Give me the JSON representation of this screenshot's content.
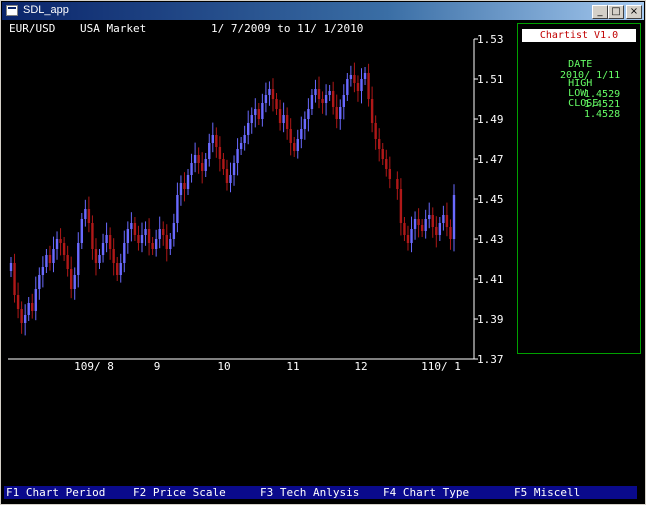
{
  "window": {
    "title": "SDL_app",
    "minimize_glyph": "_",
    "maximize_glyph": "□",
    "close_glyph": "×"
  },
  "chart_header": {
    "pair": "EUR/USD",
    "market": "USA Market",
    "range": "1/ 7/2009 to 11/ 1/2010"
  },
  "info_panel": {
    "badge": "Chartist V1.0",
    "date_label": "DATE",
    "date_value": "2010/ 1/11",
    "high_label": "HIGH",
    "high_value": "1.4529",
    "low_label": "LOW",
    "low_value": "1.4521",
    "close_label": "CLOSE",
    "close_value": "1.4528"
  },
  "menu": [
    {
      "key": "F1",
      "label": "F1 Chart Period"
    },
    {
      "key": "F2",
      "label": "F2 Price Scale"
    },
    {
      "key": "F3",
      "label": "F3 Tech Anlysis"
    },
    {
      "key": "F4",
      "label": "F4 Chart Type"
    },
    {
      "key": "F5",
      "label": "F5 Miscell"
    }
  ],
  "colors": {
    "up": "#6a6aff",
    "down": "#b01818",
    "axis": "#ffffff",
    "info_text": "#66ff66",
    "panel_border": "#00a000",
    "menu_bg": "#0a0a8c"
  },
  "chart_data": {
    "type": "candlestick",
    "ylim": [
      1.37,
      1.53
    ],
    "y_ticks": [
      1.53,
      1.51,
      1.49,
      1.47,
      1.45,
      1.43,
      1.41,
      1.39,
      1.37
    ],
    "x_ticks": [
      "109/ 8",
      "9",
      "10",
      "11",
      "12",
      "110/ 1"
    ],
    "close": [
      1.418,
      1.402,
      1.395,
      1.388,
      1.392,
      1.398,
      1.394,
      1.405,
      1.412,
      1.416,
      1.422,
      1.418,
      1.425,
      1.43,
      1.428,
      1.422,
      1.415,
      1.405,
      1.412,
      1.428,
      1.44,
      1.445,
      1.438,
      1.425,
      1.418,
      1.422,
      1.428,
      1.432,
      1.425,
      1.418,
      1.412,
      1.418,
      1.428,
      1.435,
      1.438,
      1.432,
      1.428,
      1.432,
      1.435,
      1.428,
      1.425,
      1.43,
      1.435,
      1.432,
      1.425,
      1.43,
      1.438,
      1.452,
      1.458,
      1.455,
      1.462,
      1.468,
      1.472,
      1.468,
      1.464,
      1.47,
      1.478,
      1.482,
      1.476,
      1.47,
      1.465,
      1.458,
      1.462,
      1.468,
      1.475,
      1.478,
      1.482,
      1.488,
      1.492,
      1.495,
      1.49,
      1.498,
      1.502,
      1.505,
      1.5,
      1.495,
      1.488,
      1.492,
      1.485,
      1.478,
      1.474,
      1.48,
      1.485,
      1.49,
      1.495,
      1.502,
      1.505,
      1.5,
      1.498,
      1.502,
      1.504,
      1.496,
      1.49,
      1.496,
      1.502,
      1.51,
      1.512,
      1.508,
      1.504,
      1.51,
      1.513,
      1.5,
      1.488,
      1.48,
      1.475,
      1.47,
      1.465,
      1.46,
      1.455,
      1.438,
      1.432,
      1.428,
      1.435,
      1.44,
      1.437,
      1.434,
      1.44,
      1.442,
      1.436,
      1.432,
      1.438,
      1.442,
      1.436,
      1.43,
      1.452
    ]
  }
}
